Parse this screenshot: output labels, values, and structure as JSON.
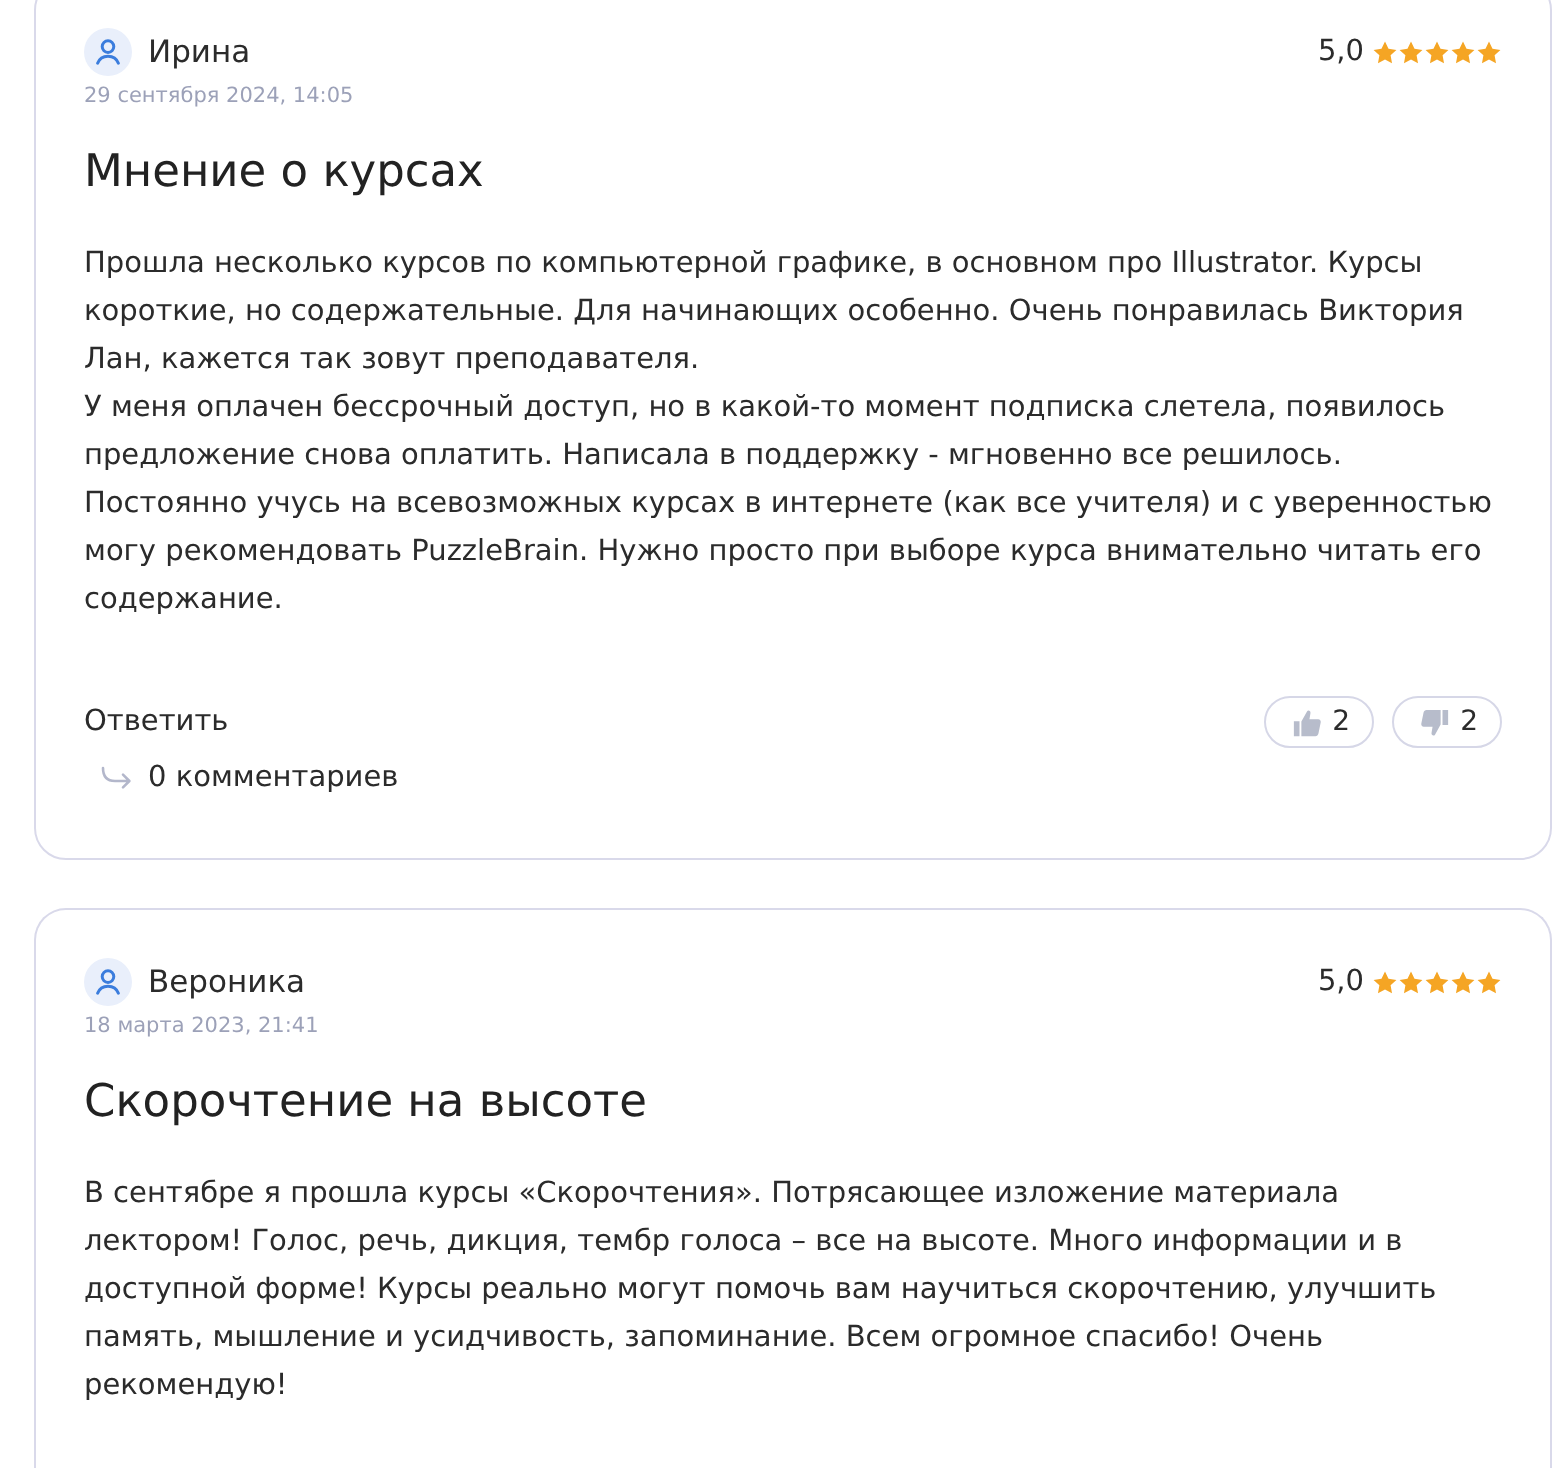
{
  "reviews": [
    {
      "author": "Ирина",
      "date": "29 сентября 2024, 14:05",
      "rating": "5,0",
      "stars": 5,
      "title": "Мнение о курсах",
      "paragraphs": [
        "Прошла несколько курсов по компьютерной графике, в основном про Illustrator. Курсы короткие, но содержательные. Для начинающих особенно. Очень понравилась Виктория Лан, кажется так зовут преподавателя.",
        "У меня оплачен бессрочный доступ, но в какой-то момент подписка слетела, появилось предложение снова оплатить. Написала в поддержку - мгновенно все решилось.",
        "Постоянно учусь на всевозможных курсах в интернете (как все учителя) и с уверенностью могу рекомендовать PuzzleBrain. Нужно просто при выборе курса внимательно читать его содержание."
      ],
      "reply_link": "Ответить",
      "comments": "0 комментариев",
      "likes": "2",
      "dislikes": "2"
    },
    {
      "author": "Вероника",
      "date": "18 марта 2023, 21:41",
      "rating": "5,0",
      "stars": 5,
      "title": "Скорочтение на высоте",
      "paragraphs": [
        "В сентябре я прошла курсы «Скорочтения». Потрясающее изложение материала лектором! Голос, речь, дикция, тембр голоса – все на высоте. Много информации и в доступной форме! Курсы реально могут помочь вам научиться скорочтению, улучшить память, мышление и усидчивость, запоминание. Всем огромное спасибо! Очень рекомендую!"
      ]
    }
  ]
}
